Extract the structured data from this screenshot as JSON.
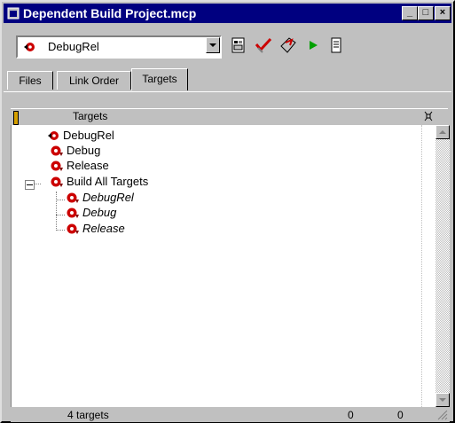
{
  "window": {
    "title": "Dependent Build Project.mcp",
    "controls": {
      "minimize": "_",
      "maximize": "□",
      "close": "×"
    }
  },
  "toolbar": {
    "target_select_value": "DebugRel",
    "tools": [
      "target-settings-icon",
      "checkmark-icon",
      "make-icon",
      "run-icon",
      "debug-icon"
    ]
  },
  "tabs": [
    {
      "label": "Files",
      "active": false
    },
    {
      "label": "Link Order",
      "active": false
    },
    {
      "label": "Targets",
      "active": true
    }
  ],
  "list": {
    "column_header": "Targets",
    "items": [
      {
        "label": "DebugRel",
        "icon": "current-target-icon",
        "indent": 0,
        "italic": false
      },
      {
        "label": "Debug",
        "icon": "target-icon",
        "indent": 0,
        "italic": false
      },
      {
        "label": "Release",
        "icon": "target-icon",
        "indent": 0,
        "italic": false
      },
      {
        "label": "Build All Targets",
        "icon": "target-icon",
        "indent": 0,
        "italic": false,
        "expanded": true
      },
      {
        "label": "DebugRel",
        "icon": "target-icon",
        "indent": 1,
        "italic": true
      },
      {
        "label": "Debug",
        "icon": "target-icon",
        "indent": 1,
        "italic": true
      },
      {
        "label": "Release",
        "icon": "target-icon",
        "indent": 1,
        "italic": true
      }
    ]
  },
  "status": {
    "target_count": "4 targets",
    "value_1": "0",
    "value_2": "0"
  },
  "colors": {
    "titlebar": "#000080",
    "face": "#c0c0c0",
    "target_icon": "#cc0000"
  }
}
